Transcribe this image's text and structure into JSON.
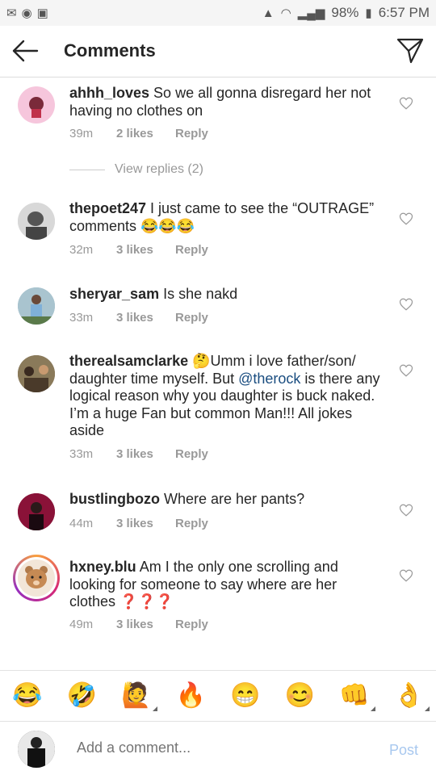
{
  "status_bar": {
    "battery": "98%",
    "time": "6:57 PM"
  },
  "header": {
    "title": "Comments"
  },
  "comments": [
    {
      "username": "ahhh_loves",
      "text": " So we all gonna disregard her not having no clothes on",
      "time": "39m",
      "likes": "2 likes",
      "reply": "Reply"
    },
    {
      "username": "thepoet247",
      "text": " I just came to see the “OUTRAGE” comments 😂😂😂",
      "time": "32m",
      "likes": "3 likes",
      "reply": "Reply"
    },
    {
      "username": "sheryar_sam",
      "text": " Is she nakd",
      "time": "33m",
      "likes": "3 likes",
      "reply": "Reply"
    },
    {
      "username": "therealsamclarke",
      "text_a": " 🤔Umm i love father/son/ daughter time myself.  But ",
      "mention": "@therock",
      "text_b": "  is there any logical reason why you daughter is buck naked.  I’m a huge Fan but common Man!!! All jokes aside",
      "time": "33m",
      "likes": "3 likes",
      "reply": "Reply"
    },
    {
      "username": "bustlingbozo",
      "text": " Where are her pants?",
      "time": "44m",
      "likes": "3 likes",
      "reply": "Reply"
    },
    {
      "username": "hxney.blu",
      "text": " Am I the only one scrolling and looking for someone to say where are her clothes ❓❓❓",
      "time": "49m",
      "likes": "3 likes",
      "reply": "Reply"
    }
  ],
  "view_replies": "View replies (2)",
  "emoji_bar": [
    "😂",
    "🤣",
    "🙋",
    "🔥",
    "😁",
    "😊",
    "👊",
    "👌"
  ],
  "composer": {
    "placeholder": "Add a comment...",
    "post": "Post"
  }
}
